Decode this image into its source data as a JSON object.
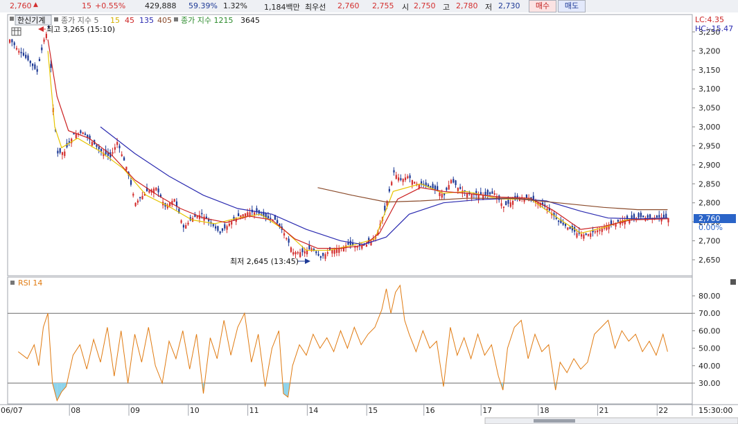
{
  "quote": {
    "price": "2,760",
    "change_arrow": "▲",
    "change": "15",
    "change_pct": "+0.55%",
    "volume": "429,888",
    "vol_ratio": "59.39%",
    "turnover_pct": "1.32%",
    "amount": "1,184백만",
    "bid_label": "최우선",
    "bid1": "2,760",
    "bid2": "2,755",
    "open_label": "시",
    "open": "2,750",
    "high_label": "고",
    "high": "2,780",
    "low_label": "저",
    "low": "2,730"
  },
  "buttons": {
    "buy": "매수",
    "sell": "매도"
  },
  "legend": {
    "stock_name": "한신기계",
    "ma_label": "종가 지수 5",
    "ma15": "15",
    "ma45": "45",
    "ma135": "135",
    "ma405": "405",
    "ma_label2": "종가 지수 1215",
    "ma3645": "3645"
  },
  "annotations": {
    "high": "최고 3,265 (15:10)",
    "low": "최저 2,645 (13:45)",
    "lc": "LC:4.35",
    "hc": "HC:-15.47"
  },
  "current": {
    "price": "2,760",
    "pct": "0.00%"
  },
  "rsi": {
    "title": "RSI 14"
  },
  "time_label": "15:30:00",
  "colors": {
    "up": "#d32f2f",
    "down": "#1e3a96",
    "ma5": "#e6c400",
    "ma15": "#cc2222",
    "ma45": "#2a2ab0",
    "ma135": "#8a4a2a",
    "rsi": "#e07a10",
    "fill": "#8fd4ec",
    "price_tag": "#2a64c8"
  },
  "chart_data": {
    "type": "candlestick",
    "price_axis": {
      "min": 2625,
      "max": 3265,
      "ticks": [
        3250,
        3200,
        3150,
        3100,
        3050,
        3000,
        2950,
        2900,
        2850,
        2800,
        2750,
        2700,
        2650
      ]
    },
    "tick_labels": [
      "3,250",
      "3,200",
      "3,150",
      "3,100",
      "3,050",
      "3,000",
      "2,950",
      "2,900",
      "2,850",
      "2,800",
      "2,750",
      "2,700",
      "2,650"
    ],
    "rsi_axis": {
      "min": 17,
      "max": 87,
      "ticks": [
        80,
        70,
        60,
        50,
        40,
        30
      ],
      "tick_labels": [
        "80.00",
        "70.00",
        "60.00",
        "50.00",
        "40.00",
        "30.00"
      ],
      "upper": 70,
      "lower": 30
    },
    "date_labels": [
      "06/07",
      "08",
      "09",
      "10",
      "11",
      "14",
      "15",
      "16",
      "17",
      "18",
      "21",
      "22"
    ],
    "price_series": [
      {
        "i": 0,
        "p": 3230
      },
      {
        "i": 4,
        "p": 3200
      },
      {
        "i": 8,
        "p": 3175
      },
      {
        "i": 12,
        "p": 3145
      },
      {
        "i": 15,
        "p": 3230
      },
      {
        "i": 17,
        "p": 3260
      },
      {
        "i": 19,
        "p": 3050
      },
      {
        "i": 21,
        "p": 2930
      },
      {
        "i": 24,
        "p": 2935
      },
      {
        "i": 28,
        "p": 2980
      },
      {
        "i": 32,
        "p": 2985
      },
      {
        "i": 36,
        "p": 2960
      },
      {
        "i": 40,
        "p": 2935
      },
      {
        "i": 44,
        "p": 2920
      },
      {
        "i": 47,
        "p": 2960
      },
      {
        "i": 51,
        "p": 2895
      },
      {
        "i": 55,
        "p": 2800
      },
      {
        "i": 60,
        "p": 2830
      },
      {
        "i": 64,
        "p": 2840
      },
      {
        "i": 68,
        "p": 2790
      },
      {
        "i": 72,
        "p": 2810
      },
      {
        "i": 76,
        "p": 2735
      },
      {
        "i": 80,
        "p": 2760
      },
      {
        "i": 84,
        "p": 2770
      },
      {
        "i": 88,
        "p": 2745
      },
      {
        "i": 92,
        "p": 2720
      },
      {
        "i": 96,
        "p": 2745
      },
      {
        "i": 100,
        "p": 2765
      },
      {
        "i": 104,
        "p": 2775
      },
      {
        "i": 108,
        "p": 2775
      },
      {
        "i": 112,
        "p": 2760
      },
      {
        "i": 116,
        "p": 2755
      },
      {
        "i": 120,
        "p": 2720
      },
      {
        "i": 124,
        "p": 2670
      },
      {
        "i": 128,
        "p": 2670
      },
      {
        "i": 132,
        "p": 2680
      },
      {
        "i": 136,
        "p": 2655
      },
      {
        "i": 140,
        "p": 2675
      },
      {
        "i": 144,
        "p": 2680
      },
      {
        "i": 148,
        "p": 2690
      },
      {
        "i": 152,
        "p": 2685
      },
      {
        "i": 156,
        "p": 2690
      },
      {
        "i": 160,
        "p": 2710
      },
      {
        "i": 164,
        "p": 2780
      },
      {
        "i": 168,
        "p": 2880
      },
      {
        "i": 171,
        "p": 2860
      },
      {
        "i": 174,
        "p": 2870
      },
      {
        "i": 178,
        "p": 2850
      },
      {
        "i": 182,
        "p": 2845
      },
      {
        "i": 186,
        "p": 2835
      },
      {
        "i": 190,
        "p": 2820
      },
      {
        "i": 193,
        "p": 2860
      },
      {
        "i": 196,
        "p": 2840
      },
      {
        "i": 200,
        "p": 2825
      },
      {
        "i": 204,
        "p": 2820
      },
      {
        "i": 208,
        "p": 2820
      },
      {
        "i": 212,
        "p": 2825
      },
      {
        "i": 216,
        "p": 2790
      },
      {
        "i": 220,
        "p": 2805
      },
      {
        "i": 224,
        "p": 2815
      },
      {
        "i": 228,
        "p": 2810
      },
      {
        "i": 232,
        "p": 2800
      },
      {
        "i": 236,
        "p": 2780
      },
      {
        "i": 240,
        "p": 2750
      },
      {
        "i": 244,
        "p": 2735
      },
      {
        "i": 248,
        "p": 2720
      },
      {
        "i": 252,
        "p": 2715
      },
      {
        "i": 256,
        "p": 2725
      },
      {
        "i": 260,
        "p": 2735
      },
      {
        "i": 264,
        "p": 2745
      },
      {
        "i": 268,
        "p": 2755
      },
      {
        "i": 272,
        "p": 2758
      },
      {
        "i": 276,
        "p": 2762
      },
      {
        "i": 280,
        "p": 2760
      },
      {
        "i": 284,
        "p": 2762
      },
      {
        "i": 288,
        "p": 2760
      }
    ],
    "ma_series": [
      {
        "name": "5",
        "pts": [
          {
            "i": 17,
            "p": 3200
          },
          {
            "i": 20,
            "p": 3000
          },
          {
            "i": 23,
            "p": 2945
          },
          {
            "i": 30,
            "p": 2970
          },
          {
            "i": 40,
            "p": 2935
          },
          {
            "i": 50,
            "p": 2890
          },
          {
            "i": 60,
            "p": 2820
          },
          {
            "i": 70,
            "p": 2790
          },
          {
            "i": 80,
            "p": 2755
          },
          {
            "i": 90,
            "p": 2745
          },
          {
            "i": 100,
            "p": 2760
          },
          {
            "i": 110,
            "p": 2770
          },
          {
            "i": 120,
            "p": 2730
          },
          {
            "i": 130,
            "p": 2675
          },
          {
            "i": 140,
            "p": 2675
          },
          {
            "i": 150,
            "p": 2688
          },
          {
            "i": 160,
            "p": 2705
          },
          {
            "i": 168,
            "p": 2830
          },
          {
            "i": 180,
            "p": 2850
          },
          {
            "i": 190,
            "p": 2825
          },
          {
            "i": 200,
            "p": 2830
          },
          {
            "i": 215,
            "p": 2810
          },
          {
            "i": 228,
            "p": 2810
          },
          {
            "i": 240,
            "p": 2760
          },
          {
            "i": 250,
            "p": 2720
          },
          {
            "i": 260,
            "p": 2735
          },
          {
            "i": 270,
            "p": 2755
          },
          {
            "i": 288,
            "p": 2760
          }
        ]
      },
      {
        "name": "15",
        "pts": [
          {
            "i": 17,
            "p": 3230
          },
          {
            "i": 21,
            "p": 3080
          },
          {
            "i": 26,
            "p": 2990
          },
          {
            "i": 35,
            "p": 2970
          },
          {
            "i": 45,
            "p": 2925
          },
          {
            "i": 55,
            "p": 2860
          },
          {
            "i": 65,
            "p": 2820
          },
          {
            "i": 75,
            "p": 2785
          },
          {
            "i": 85,
            "p": 2760
          },
          {
            "i": 95,
            "p": 2748
          },
          {
            "i": 105,
            "p": 2765
          },
          {
            "i": 115,
            "p": 2755
          },
          {
            "i": 125,
            "p": 2705
          },
          {
            "i": 135,
            "p": 2680
          },
          {
            "i": 145,
            "p": 2680
          },
          {
            "i": 155,
            "p": 2688
          },
          {
            "i": 162,
            "p": 2720
          },
          {
            "i": 170,
            "p": 2810
          },
          {
            "i": 180,
            "p": 2840
          },
          {
            "i": 190,
            "p": 2830
          },
          {
            "i": 200,
            "p": 2825
          },
          {
            "i": 215,
            "p": 2815
          },
          {
            "i": 228,
            "p": 2812
          },
          {
            "i": 238,
            "p": 2780
          },
          {
            "i": 250,
            "p": 2730
          },
          {
            "i": 260,
            "p": 2738
          },
          {
            "i": 272,
            "p": 2755
          },
          {
            "i": 288,
            "p": 2758
          }
        ]
      },
      {
        "name": "45",
        "pts": [
          {
            "i": 40,
            "p": 3000
          },
          {
            "i": 55,
            "p": 2930
          },
          {
            "i": 70,
            "p": 2870
          },
          {
            "i": 85,
            "p": 2820
          },
          {
            "i": 100,
            "p": 2785
          },
          {
            "i": 115,
            "p": 2770
          },
          {
            "i": 130,
            "p": 2730
          },
          {
            "i": 145,
            "p": 2700
          },
          {
            "i": 155,
            "p": 2690
          },
          {
            "i": 165,
            "p": 2710
          },
          {
            "i": 175,
            "p": 2770
          },
          {
            "i": 190,
            "p": 2800
          },
          {
            "i": 205,
            "p": 2808
          },
          {
            "i": 220,
            "p": 2812
          },
          {
            "i": 235,
            "p": 2805
          },
          {
            "i": 250,
            "p": 2778
          },
          {
            "i": 262,
            "p": 2760
          },
          {
            "i": 275,
            "p": 2758
          },
          {
            "i": 288,
            "p": 2760
          }
        ]
      },
      {
        "name": "135",
        "pts": [
          {
            "i": 135,
            "p": 2840
          },
          {
            "i": 150,
            "p": 2820
          },
          {
            "i": 165,
            "p": 2802
          },
          {
            "i": 180,
            "p": 2805
          },
          {
            "i": 200,
            "p": 2812
          },
          {
            "i": 220,
            "p": 2812
          },
          {
            "i": 240,
            "p": 2800
          },
          {
            "i": 260,
            "p": 2788
          },
          {
            "i": 275,
            "p": 2782
          },
          {
            "i": 288,
            "p": 2782
          }
        ]
      }
    ],
    "rsi_series": [
      {
        "i": 4,
        "v": 48
      },
      {
        "i": 8,
        "v": 44
      },
      {
        "i": 11,
        "v": 52
      },
      {
        "i": 13,
        "v": 40
      },
      {
        "i": 15,
        "v": 62
      },
      {
        "i": 17,
        "v": 70
      },
      {
        "i": 19,
        "v": 30
      },
      {
        "i": 21,
        "v": 20
      },
      {
        "i": 23,
        "v": 25
      },
      {
        "i": 25,
        "v": 28
      },
      {
        "i": 28,
        "v": 46
      },
      {
        "i": 31,
        "v": 52
      },
      {
        "i": 34,
        "v": 38
      },
      {
        "i": 37,
        "v": 55
      },
      {
        "i": 40,
        "v": 42
      },
      {
        "i": 43,
        "v": 62
      },
      {
        "i": 46,
        "v": 34
      },
      {
        "i": 49,
        "v": 60
      },
      {
        "i": 52,
        "v": 30
      },
      {
        "i": 55,
        "v": 58
      },
      {
        "i": 58,
        "v": 42
      },
      {
        "i": 61,
        "v": 62
      },
      {
        "i": 64,
        "v": 40
      },
      {
        "i": 67,
        "v": 30
      },
      {
        "i": 70,
        "v": 54
      },
      {
        "i": 73,
        "v": 44
      },
      {
        "i": 76,
        "v": 60
      },
      {
        "i": 79,
        "v": 38
      },
      {
        "i": 82,
        "v": 58
      },
      {
        "i": 85,
        "v": 24
      },
      {
        "i": 88,
        "v": 56
      },
      {
        "i": 91,
        "v": 44
      },
      {
        "i": 94,
        "v": 66
      },
      {
        "i": 97,
        "v": 46
      },
      {
        "i": 100,
        "v": 62
      },
      {
        "i": 103,
        "v": 70
      },
      {
        "i": 106,
        "v": 42
      },
      {
        "i": 109,
        "v": 58
      },
      {
        "i": 112,
        "v": 28
      },
      {
        "i": 115,
        "v": 50
      },
      {
        "i": 118,
        "v": 60
      },
      {
        "i": 120,
        "v": 24
      },
      {
        "i": 122,
        "v": 22
      },
      {
        "i": 124,
        "v": 40
      },
      {
        "i": 127,
        "v": 52
      },
      {
        "i": 130,
        "v": 46
      },
      {
        "i": 133,
        "v": 58
      },
      {
        "i": 136,
        "v": 50
      },
      {
        "i": 139,
        "v": 56
      },
      {
        "i": 142,
        "v": 48
      },
      {
        "i": 145,
        "v": 60
      },
      {
        "i": 148,
        "v": 50
      },
      {
        "i": 151,
        "v": 62
      },
      {
        "i": 154,
        "v": 52
      },
      {
        "i": 157,
        "v": 58
      },
      {
        "i": 160,
        "v": 62
      },
      {
        "i": 163,
        "v": 72
      },
      {
        "i": 165,
        "v": 84
      },
      {
        "i": 167,
        "v": 70
      },
      {
        "i": 169,
        "v": 82
      },
      {
        "i": 171,
        "v": 86
      },
      {
        "i": 173,
        "v": 66
      },
      {
        "i": 175,
        "v": 58
      },
      {
        "i": 178,
        "v": 48
      },
      {
        "i": 181,
        "v": 60
      },
      {
        "i": 184,
        "v": 50
      },
      {
        "i": 187,
        "v": 54
      },
      {
        "i": 190,
        "v": 28
      },
      {
        "i": 193,
        "v": 62
      },
      {
        "i": 196,
        "v": 46
      },
      {
        "i": 199,
        "v": 56
      },
      {
        "i": 202,
        "v": 44
      },
      {
        "i": 205,
        "v": 58
      },
      {
        "i": 208,
        "v": 46
      },
      {
        "i": 211,
        "v": 52
      },
      {
        "i": 214,
        "v": 34
      },
      {
        "i": 216,
        "v": 26
      },
      {
        "i": 218,
        "v": 50
      },
      {
        "i": 221,
        "v": 62
      },
      {
        "i": 224,
        "v": 66
      },
      {
        "i": 227,
        "v": 44
      },
      {
        "i": 230,
        "v": 58
      },
      {
        "i": 233,
        "v": 48
      },
      {
        "i": 236,
        "v": 52
      },
      {
        "i": 239,
        "v": 26
      },
      {
        "i": 241,
        "v": 42
      },
      {
        "i": 244,
        "v": 36
      },
      {
        "i": 247,
        "v": 44
      },
      {
        "i": 250,
        "v": 38
      },
      {
        "i": 253,
        "v": 42
      },
      {
        "i": 256,
        "v": 58
      },
      {
        "i": 259,
        "v": 62
      },
      {
        "i": 262,
        "v": 66
      },
      {
        "i": 265,
        "v": 50
      },
      {
        "i": 268,
        "v": 60
      },
      {
        "i": 271,
        "v": 54
      },
      {
        "i": 274,
        "v": 58
      },
      {
        "i": 277,
        "v": 48
      },
      {
        "i": 280,
        "v": 54
      },
      {
        "i": 283,
        "v": 46
      },
      {
        "i": 286,
        "v": 58
      },
      {
        "i": 288,
        "v": 48
      }
    ]
  }
}
